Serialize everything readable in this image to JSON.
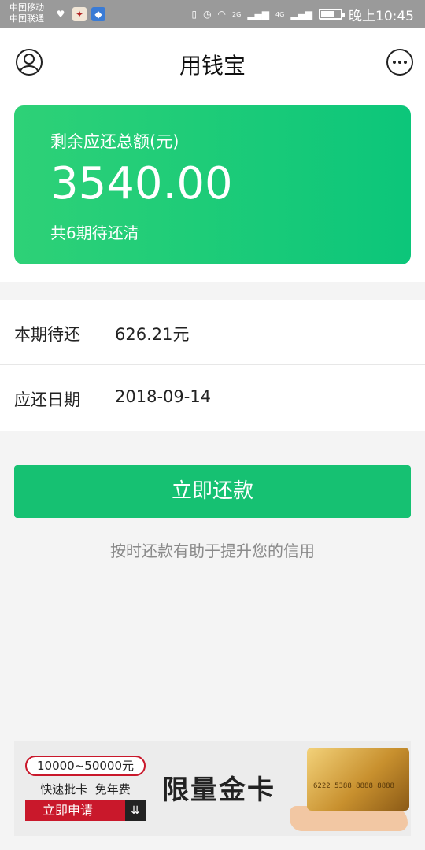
{
  "status_bar": {
    "carrier1": "中国移动",
    "carrier2": "中国联通",
    "net1": "2G",
    "net2": "4G",
    "time": "晚上10:45",
    "battery_level": 0.7
  },
  "header": {
    "title": "用钱宝",
    "left_icon": "user-icon",
    "right_icon": "more-icon"
  },
  "summary_card": {
    "label": "剩余应还总额(元)",
    "amount": "3540.00",
    "periods": "共6期待还清",
    "gradient_start": "#2ed177",
    "gradient_end": "#0cc67a"
  },
  "details": {
    "current_label": "本期待还",
    "current_value": "626.21元",
    "date_label": "应还日期",
    "date_value": "2018-09-14"
  },
  "actions": {
    "pay_button": "立即还款",
    "hint": "按时还款有助于提升您的信用",
    "accent": "#16c172"
  },
  "ad": {
    "range": "10000~50000元",
    "features": "快速批卡  免年费",
    "apply": "立即申请",
    "apply_icon": "double-arrow-down-icon",
    "headline": "限量金卡",
    "card_number": "6222 5388 8888 8888"
  }
}
